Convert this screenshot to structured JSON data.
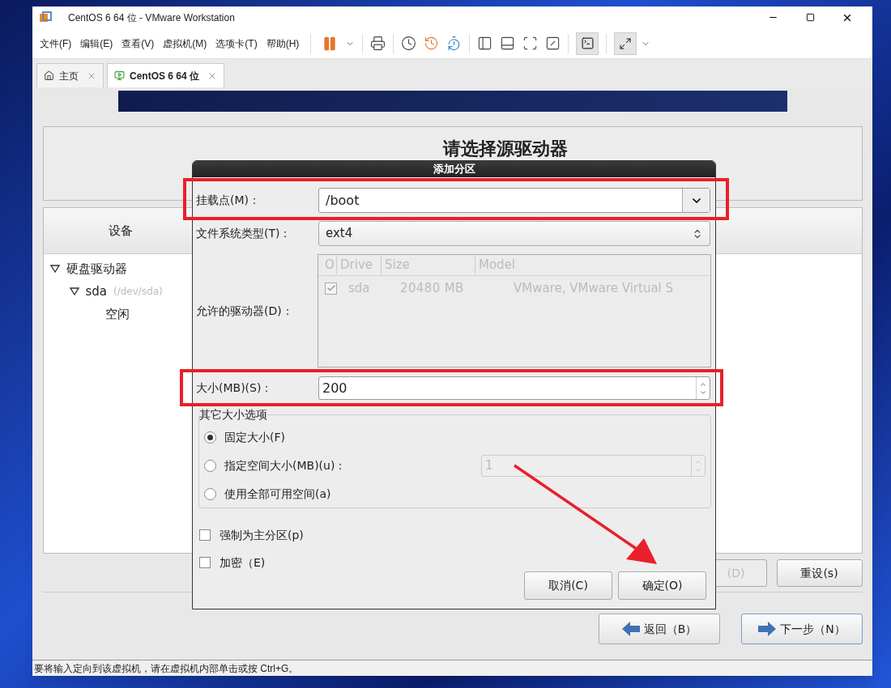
{
  "window": {
    "title": "CentOS 6 64 位 - VMware Workstation"
  },
  "menu": [
    "文件(F)",
    "编辑(E)",
    "查看(V)",
    "虚拟机(M)",
    "选项卡(T)",
    "帮助(H)"
  ],
  "tabs": [
    {
      "kind": "home",
      "label": "主页",
      "selected": false
    },
    {
      "kind": "vm",
      "label": "CentOS 6 64 位",
      "selected": true
    }
  ],
  "installer": {
    "section_title": "请选择源驱动器",
    "devices_header": "设备",
    "tree": [
      {
        "label": "硬盘驱动器",
        "expanded": true,
        "children": [
          {
            "label": "sda",
            "sublabel": "(/dev/sda)",
            "expanded": true,
            "children": [
              {
                "label": "空闲"
              }
            ]
          }
        ]
      }
    ],
    "buttons": [
      {
        "label": "(D)",
        "disabled": true
      },
      {
        "label": "重设(s)",
        "disabled": false
      }
    ],
    "nav": [
      {
        "kind": "back",
        "label": "返回（B）"
      },
      {
        "kind": "next",
        "label": "下一步（N）"
      }
    ]
  },
  "dialog": {
    "title": "添加分区",
    "mount_point": {
      "label": "挂载点(M)：",
      "value": "/boot"
    },
    "fs_type": {
      "label": "文件系统类型(T)：",
      "value": "ext4"
    },
    "drives": {
      "label": "允许的驱动器(D)：",
      "columns": [
        "O",
        "Drive",
        "Size",
        "Model"
      ],
      "rows": [
        {
          "checked": true,
          "drive": "sda",
          "size": "20480 MB",
          "model": "VMware, VMware Virtual S"
        }
      ]
    },
    "size": {
      "label": "大小(MB)(S)：",
      "value": "200"
    },
    "size_options": {
      "title": "其它大小选项",
      "options": [
        {
          "label": "固定大小(F)",
          "selected": true
        },
        {
          "label": "指定空间大小(MB)(u)：",
          "selected": false,
          "value": "1"
        },
        {
          "label": "使用全部可用空间(a)",
          "selected": false
        }
      ]
    },
    "checkboxes": [
      {
        "label": "强制为主分区(p)",
        "checked": false
      },
      {
        "label": "加密（E)",
        "checked": false
      }
    ],
    "buttons": [
      "取消(C)",
      "确定(O)"
    ]
  },
  "status_bar": {
    "text": "要将输入定向到该虚拟机，请在虚拟机内部单击或按 Ctrl+G。"
  }
}
